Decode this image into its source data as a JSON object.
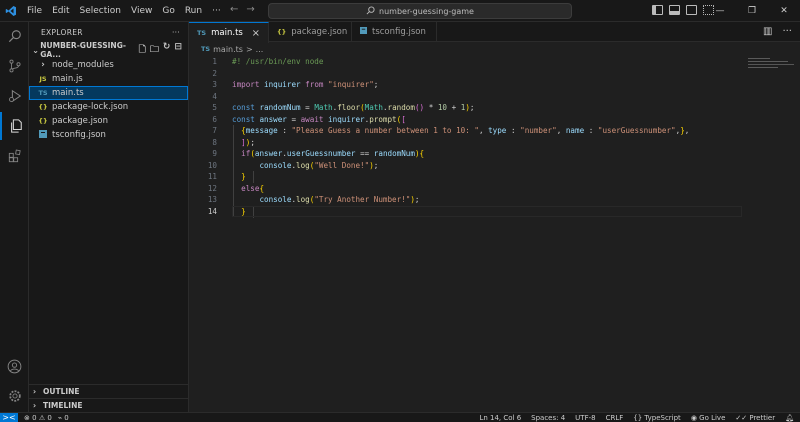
{
  "titlebar": {
    "menu": [
      "File",
      "Edit",
      "Selection",
      "View",
      "Go",
      "Run",
      "···"
    ],
    "search_text": "number-guessing-game",
    "logo_icon": "vscode-logo-icon",
    "accent_color": "#0078d4"
  },
  "sidebar": {
    "header": "EXPLORER",
    "header_more": "···",
    "folder": "NUMBER-GUESSING-GA...",
    "items": [
      {
        "label": "node_modules",
        "icon": "›",
        "type": "folder"
      },
      {
        "label": "main.js",
        "icon": "JS",
        "type": "js"
      },
      {
        "label": "main.ts",
        "icon": "TS",
        "type": "ts",
        "selected": true
      },
      {
        "label": "package-lock.json",
        "icon": "{}",
        "type": "json"
      },
      {
        "label": "package.json",
        "icon": "{}",
        "type": "json"
      },
      {
        "label": "tsconfig.json",
        "icon": "tsconfig-icon",
        "type": "tsconfig"
      }
    ],
    "outline": "OUTLINE",
    "timeline": "TIMELINE"
  },
  "tabs": [
    {
      "label": "main.ts",
      "icon": "TS",
      "active": true,
      "close": "×"
    },
    {
      "label": "package.json",
      "icon": "{}",
      "active": false
    },
    {
      "label": "tsconfig.json",
      "icon": "tsconfig-icon",
      "active": false
    }
  ],
  "breadcrumb": {
    "icon": "TS",
    "file": "main.ts",
    "sep": ">",
    "rest": "..."
  },
  "editor": {
    "current_line": 14,
    "lines": [
      {
        "n": "1",
        "t": "#! /usr/bin/env node"
      },
      {
        "n": "2",
        "t": ""
      },
      {
        "n": "3",
        "t": "import inquirer from \"inquirer\";"
      },
      {
        "n": "4",
        "t": ""
      },
      {
        "n": "5",
        "t": "const randomNum = Math.floor(Math.random() * 10 + 1);"
      },
      {
        "n": "6",
        "t": "const answer = await inquirer.prompt(["
      },
      {
        "n": "7",
        "t": "  {message : \"Please Guess a number between 1 to 10: \", type : \"number\", name : \"userGuessnumber\",},"
      },
      {
        "n": "8",
        "t": "  ]);"
      },
      {
        "n": "9",
        "t": "  if(answer.userGuessnumber == randomNum){"
      },
      {
        "n": "10",
        "t": "      console.log(\"Well Done!\");"
      },
      {
        "n": "11",
        "t": "  }"
      },
      {
        "n": "12",
        "t": "  else{"
      },
      {
        "n": "13",
        "t": "      console.log(\"Try Another Number!\");"
      },
      {
        "n": "14",
        "t": "  }"
      }
    ]
  },
  "statusbar": {
    "remote": "><",
    "errors": "0",
    "warnings": "0",
    "ports": "0",
    "position": "Ln 14, Col 6",
    "spaces": "Spaces: 4",
    "encoding": "UTF-8",
    "eol": "CRLF",
    "language": "TypeScript",
    "golive": "Go Live",
    "prettier": "Prettier"
  }
}
